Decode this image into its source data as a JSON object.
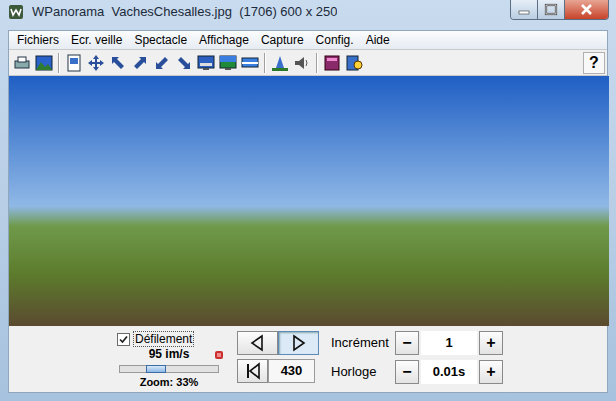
{
  "window": {
    "title": "WPanorama  VachesChesalles.jpg  (1706) 600 x 250"
  },
  "menu": [
    "Fichiers",
    "Ecr. veille",
    "Spectacle",
    "Affichage",
    "Capture",
    "Config.",
    "Aide"
  ],
  "toolbar": {
    "help": "?"
  },
  "controls": {
    "scroll": {
      "label": "Défilement",
      "checked": true
    },
    "speed": "95 im/s",
    "zoom": {
      "label": "Zoom: 33%",
      "level": 0.33
    },
    "nav": {
      "prev_selected": false,
      "next_selected": true,
      "position": "430"
    },
    "increment": {
      "label": "Incrément",
      "value": "1",
      "minus": "−",
      "plus": "+"
    },
    "clock": {
      "label": "Horloge",
      "value": "0.01s",
      "minus": "−",
      "plus": "+"
    }
  }
}
